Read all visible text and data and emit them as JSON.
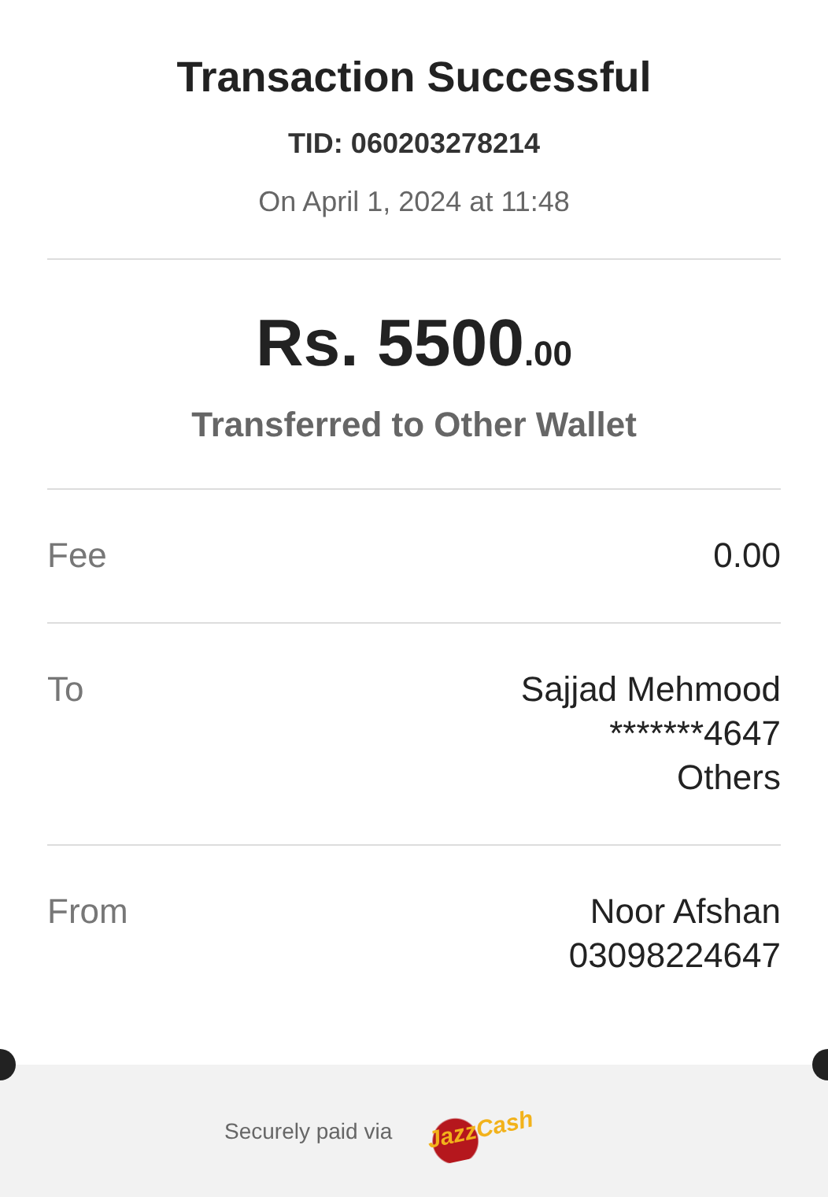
{
  "title": "Transaction Successful",
  "tid": "TID: 060203278214",
  "datetime": "On April 1, 2024 at 11:48",
  "amount": {
    "main": "Rs. 5500",
    "decimal": ".00"
  },
  "description": "Transferred to Other Wallet",
  "details": [
    {
      "label": "Fee",
      "values": [
        "0.00"
      ]
    },
    {
      "label": "To",
      "values": [
        "Sajjad Mehmood",
        "*******4647",
        "Others"
      ]
    },
    {
      "label": "From",
      "values": [
        "Noor Afshan",
        "03098224647"
      ]
    }
  ],
  "footer": {
    "text": "Securely paid via",
    "logo": "JazzCash"
  }
}
